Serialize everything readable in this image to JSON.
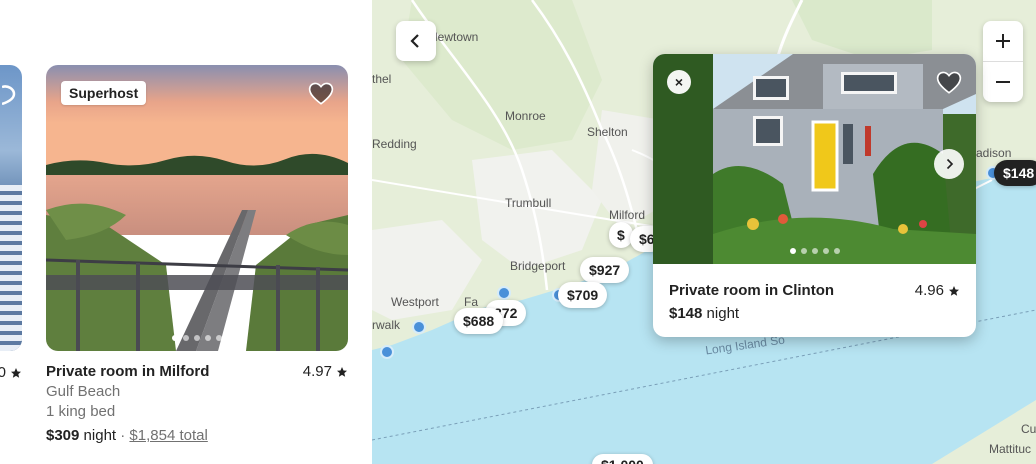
{
  "partial_card": {
    "rating": "0"
  },
  "listing": {
    "badge": "Superhost",
    "title": "Private room in Milford",
    "rating": "4.97",
    "location": "Gulf Beach",
    "beds": "1 king bed",
    "price": "$309",
    "price_unit": "night",
    "separator": "·",
    "total": "$1,854 total",
    "photo_dots": 5,
    "active_dot": 0
  },
  "map": {
    "labels": {
      "newtown": "Newtown",
      "bethel": "thel",
      "monroe": "Monroe",
      "shelton": "Shelton",
      "redding": "Redding",
      "trumbull": "Trumbull",
      "milford": "Milford",
      "bridgeport": "Bridgeport",
      "westport": "Westport",
      "fairfield": "Fa",
      "norwalk": "rwalk",
      "madison": "adison",
      "long_island_sound": "Long Island So",
      "cu": "Cu",
      "mattituck": "Mattituc"
    },
    "pins": {
      "p927": "$927",
      "p709": "$709",
      "p688": "$688",
      "p872": "872",
      "p_milford_a": "$",
      "p_milford_b": "$6",
      "p148": "$148",
      "p_bottom": "$1,000"
    }
  },
  "popup": {
    "title": "Private room in Clinton",
    "rating": "4.96",
    "price": "$148",
    "price_unit": "night",
    "close_glyph": "×",
    "photo_dots": 5,
    "active_dot": 0
  },
  "colors": {
    "water": "#b7e4f2",
    "land": "#e6eed9",
    "pin_bg": "#ffffff",
    "pin_dark_bg": "#222222",
    "text": "#222222",
    "muted": "#717171"
  },
  "icons": {
    "star": "star-icon",
    "heart": "heart-icon",
    "back": "chevron-left-icon",
    "zoom_in": "plus-icon",
    "zoom_out": "minus-icon",
    "close": "close-icon",
    "next": "chevron-right-icon"
  }
}
